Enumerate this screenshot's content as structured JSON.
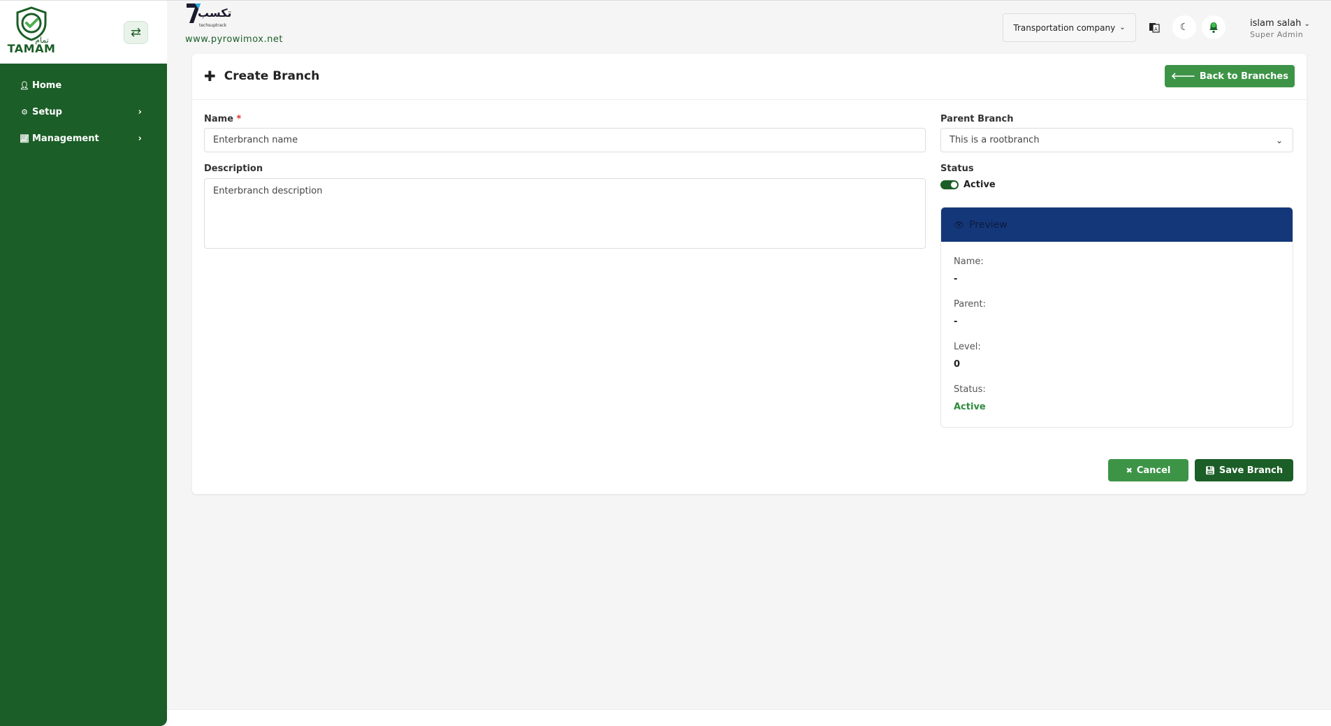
{
  "sidebar": {
    "logo_text": "TAMAM",
    "logo_arabic": "تمام",
    "toggle_icon": "swap-arrows-icon",
    "items": [
      {
        "label": "Home",
        "icon": "user-icon"
      },
      {
        "label": "Setup",
        "icon": "gears-icon"
      },
      {
        "label": "Management",
        "icon": "line-chart-icon"
      }
    ]
  },
  "header": {
    "brand_arabic": "تكسب",
    "brand_small": "techsuptrack",
    "brand_url": "www.pyrowimox.net",
    "company": "Transportation company",
    "user_name": "islam salah",
    "user_role": "Super Admin"
  },
  "page": {
    "title": "Create Branch",
    "back_label": "Back to Branches",
    "name_label": "Name",
    "name_required": "*",
    "name_placeholder": "Enterbranch name",
    "description_label": "Description",
    "description_placeholder": "Enterbranch description",
    "parent_label": "Parent Branch",
    "parent_value": "This is a rootbranch",
    "status_label": "Status",
    "status_value": "Active",
    "cancel_label": "Cancel",
    "save_label": "Save Branch"
  },
  "preview": {
    "title": "Preview",
    "name_label": "Name:",
    "name_value": "-",
    "parent_label": "Parent:",
    "parent_value": "-",
    "level_label": "Level:",
    "level_value": "0",
    "status_label": "Status:",
    "status_value": "Active"
  },
  "colors": {
    "sidebar_bg": "#1b5e27",
    "primary_button": "#3d9447",
    "save_button": "#1b5e27",
    "preview_header": "#14377a",
    "active_text": "#2e8b3e"
  }
}
